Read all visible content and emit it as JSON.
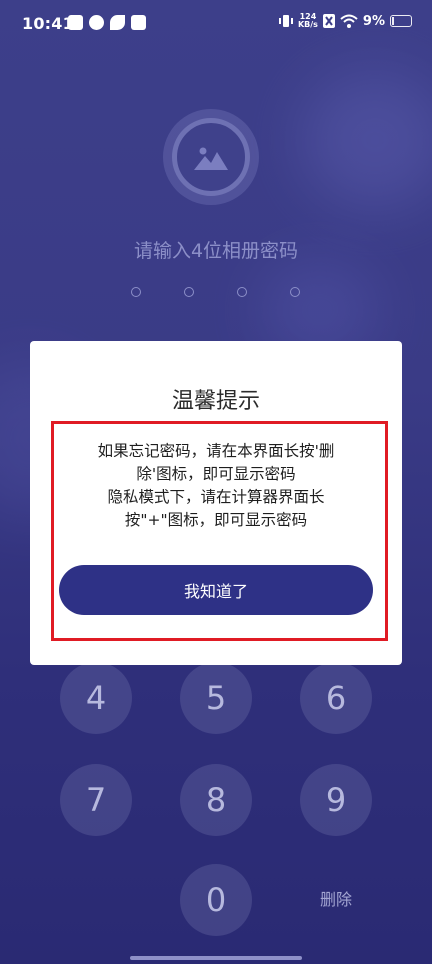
{
  "status_bar": {
    "time": "10:41",
    "network_speed_top": "124",
    "network_speed_bottom": "KB/s",
    "battery_percent": "9%"
  },
  "lock_screen": {
    "prompt": "请输入4位相册密码",
    "pin_length": 4,
    "keys": [
      "4",
      "5",
      "6",
      "7",
      "8",
      "9",
      "0"
    ],
    "delete_label": "删除"
  },
  "dialog": {
    "title": "温馨提示",
    "message_lines": [
      "如果忘记密码，请在本界面长按'删",
      "除'图标，即可显示密码",
      "隐私模式下，请在计算器界面长",
      "按\"+\"图标，即可显示密码"
    ],
    "ok_button": "我知道了"
  },
  "colors": {
    "background": "#3a3b86",
    "button": "#2e3186",
    "highlight": "#e01b24"
  }
}
